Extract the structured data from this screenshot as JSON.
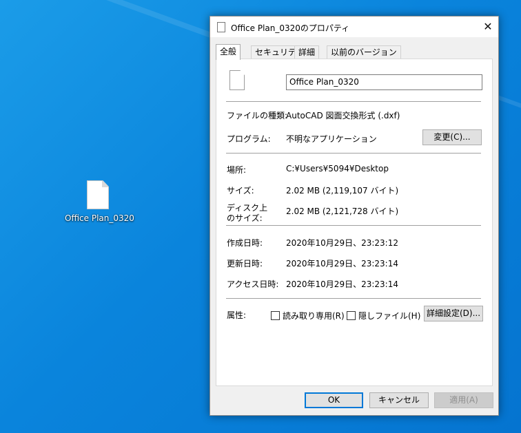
{
  "desktop": {
    "icon_label": "Office Plan_0320"
  },
  "window": {
    "title": "Office Plan_0320のプロパティ",
    "close_glyph": "✕",
    "tabs": [
      "全般",
      "セキュリティ",
      "詳細",
      "以前のバージョン"
    ],
    "active_tab": "全般"
  },
  "general": {
    "file_name": "Office Plan_0320",
    "file_type_label": "ファイルの種類:",
    "file_type_value": "AutoCAD 図面交換形式 (.dxf)",
    "program_label": "プログラム:",
    "program_value": "不明なアプリケーション",
    "change_button": "変更(C)...",
    "location_label": "場所:",
    "location_value": "C:¥Users¥5094¥Desktop",
    "size_label": "サイズ:",
    "size_value": "2.02 MB (2,119,107 バイト)",
    "disk_size_label_1": "ディスク上",
    "disk_size_label_2": "のサイズ:",
    "disk_size_value": "2.02 MB (2,121,728 バイト)",
    "created_label": "作成日時:",
    "created_value": "2020年10月29日、23:23:12",
    "modified_label": "更新日時:",
    "modified_value": "2020年10月29日、23:23:14",
    "accessed_label": "アクセス日時:",
    "accessed_value": "2020年10月29日、23:23:14",
    "attributes_label": "属性:",
    "readonly_label": "読み取り専用(R)",
    "readonly_checked": false,
    "hidden_label": "隠しファイル(H)",
    "hidden_checked": false,
    "advanced_button": "詳細設定(D)..."
  },
  "footer": {
    "ok": "OK",
    "cancel": "キャンセル",
    "apply": "適用(A)"
  }
}
